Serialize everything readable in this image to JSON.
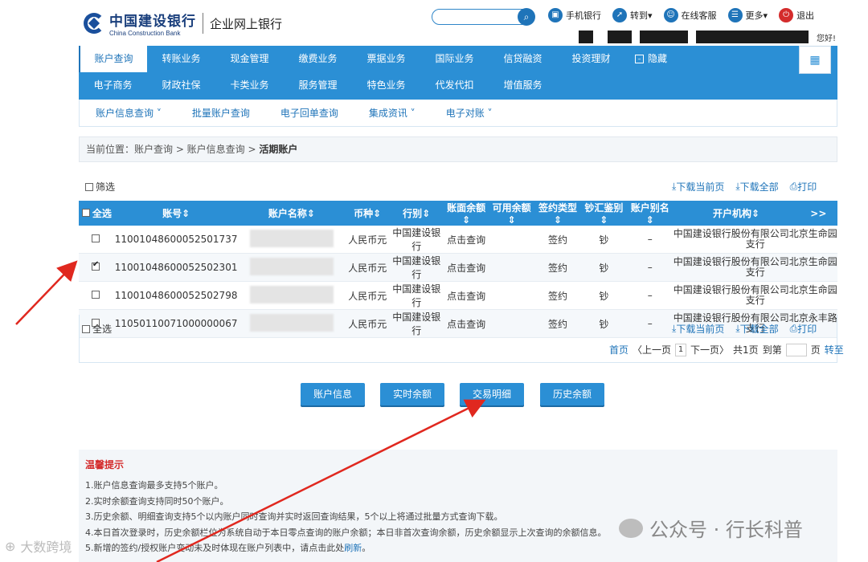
{
  "header": {
    "bank_name_cn": "中国建设银行",
    "bank_name_en": "China Construction Bank",
    "subtitle": "企业网上银行",
    "top_links": [
      {
        "label": "手机银行",
        "icon": "phone-icon"
      },
      {
        "label": "转到▾",
        "icon": "arrow-icon"
      },
      {
        "label": "在线客服",
        "icon": "service-icon"
      },
      {
        "label": "更多▾",
        "icon": "more-icon"
      },
      {
        "label": "退出",
        "icon": "power-icon"
      }
    ],
    "greeting": "您好!"
  },
  "nav": {
    "row1": [
      "账户查询",
      "转账业务",
      "现金管理",
      "缴费业务",
      "票据业务",
      "国际业务",
      "信贷融资",
      "投资理财"
    ],
    "hide_label": "隐藏",
    "row2": [
      "电子商务",
      "财政社保",
      "卡类业务",
      "服务管理",
      "特色业务",
      "代发代扣",
      "增值服务"
    ]
  },
  "subnav": [
    "账户信息查询 ˅",
    "批量账户查询",
    "电子回单查询",
    "集成资讯 ˅",
    "电子对账 ˅"
  ],
  "breadcrumb": {
    "prefix": "当前位置：账户查询 > 账户信息查询 > ",
    "current": "活期账户"
  },
  "filter_label": "筛选",
  "actions": {
    "download_page": "下载当前页",
    "download_all": "下载全部",
    "print": "打印"
  },
  "table": {
    "select_all": "全选",
    "headers": [
      "账号",
      "账户名称",
      "币种",
      "行别",
      "账面余额",
      "可用余额",
      "签约类型",
      "钞汇鉴别",
      "账户别名",
      "开户机构"
    ],
    "more": ">>",
    "rows": [
      {
        "checked": false,
        "account": "11001048600052501737",
        "currency": "人民币元",
        "bank": "中国建设银行",
        "balance": "点击查询",
        "sign": "签约",
        "cash": "钞",
        "alias": "–",
        "org": "中国建设银行股份有限公司北京生命园支行"
      },
      {
        "checked": true,
        "account": "11001048600052502301",
        "currency": "人民币元",
        "bank": "中国建设银行",
        "balance": "点击查询",
        "sign": "签约",
        "cash": "钞",
        "alias": "–",
        "org": "中国建设银行股份有限公司北京生命园支行"
      },
      {
        "checked": false,
        "account": "11001048600052502798",
        "currency": "人民币元",
        "bank": "中国建设银行",
        "balance": "点击查询",
        "sign": "签约",
        "cash": "钞",
        "alias": "–",
        "org": "中国建设银行股份有限公司北京生命园支行"
      },
      {
        "checked": false,
        "account": "11050110071000000067",
        "currency": "人民币元",
        "bank": "中国建设银行",
        "balance": "点击查询",
        "sign": "签约",
        "cash": "钞",
        "alias": "–",
        "org": "中国建设银行股份有限公司北京永丰路支行"
      }
    ]
  },
  "pager": {
    "first": "首页",
    "prev": "〈上一页",
    "page": "1",
    "next": "下一页〉",
    "total": "共1页",
    "goto": "到第",
    "page_unit": "页",
    "go": "转至"
  },
  "buttons": [
    "账户信息",
    "实时余额",
    "交易明细",
    "历史余额"
  ],
  "tips": {
    "title": "温馨提示",
    "items": [
      "1.账户信息查询最多支持5个账户。",
      "2.实时余额查询支持同时50个账户。",
      "3.历史余额、明细查询支持5个以内账户同时查询并实时返回查询结果，5个以上将通过批量方式查询下载。",
      "4.本日首次登录时，历史余额栏位为系统自动于本日零点查询的账户余额；本日非首次查询余额，历史余额显示上次查询的余额信息。",
      "5.新增的签约/授权账户变动未及时体现在账户列表中，请点击此处"
    ],
    "refresh_link": "刷新",
    "tail": "。"
  },
  "watermarks": {
    "left": "大数跨境",
    "right": "公众号 · 行长科普"
  },
  "colors": {
    "primary": "#2b8fd5",
    "link": "#1f74b9",
    "alert": "#d42c2c"
  }
}
